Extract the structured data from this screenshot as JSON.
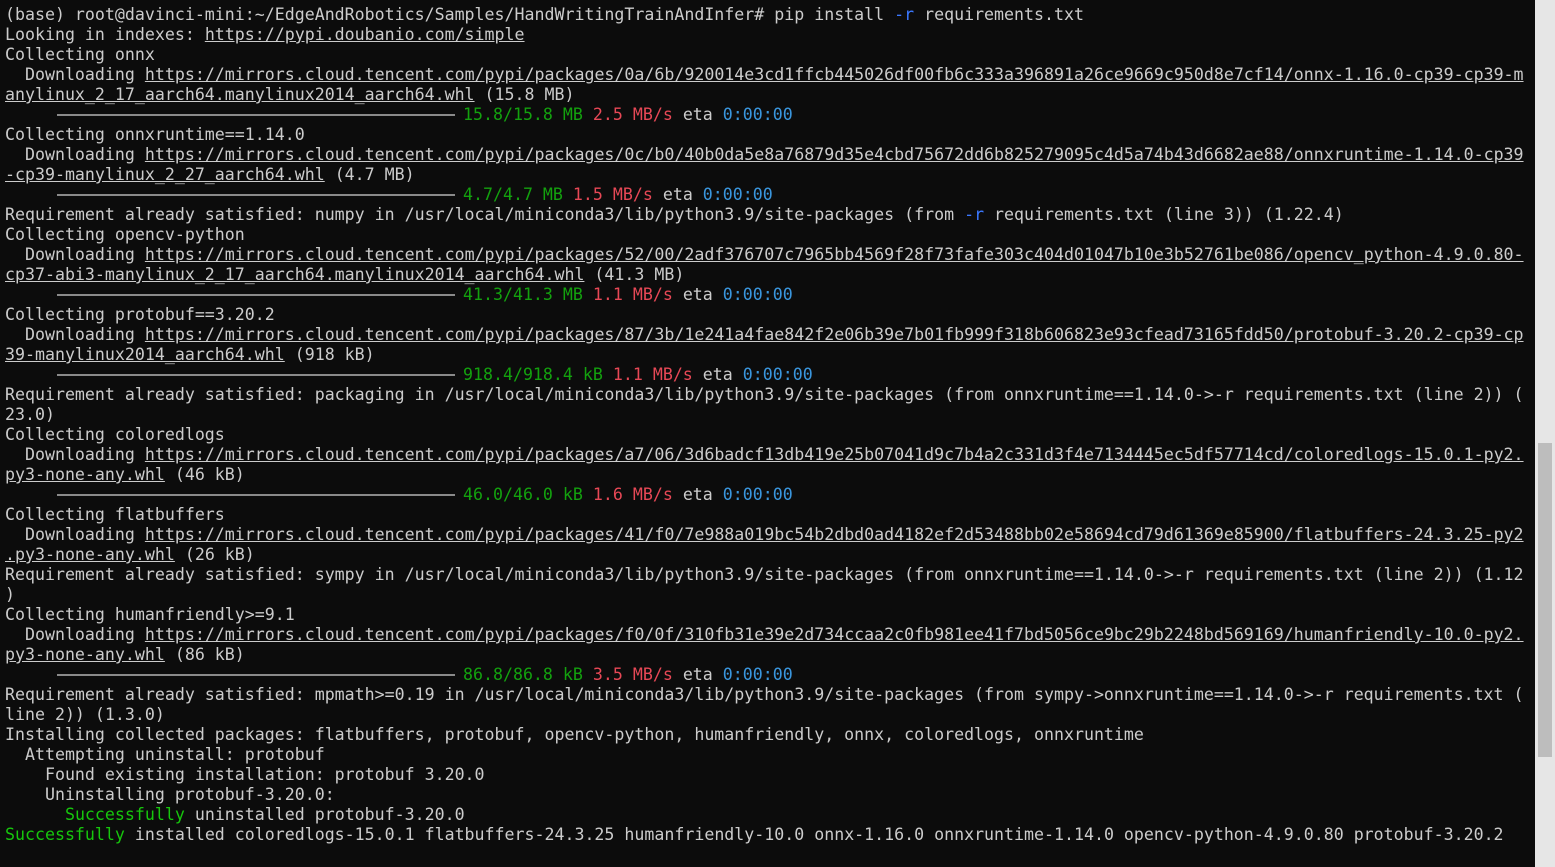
{
  "terminal": {
    "lines": [
      [
        {
          "t": "(base) root@davinci-mini:~/EdgeAndRobotics/Samples/HandWritingTrainAndInfer# pip install "
        },
        {
          "t": "-r",
          "c": "blue"
        },
        {
          "t": " requirements.txt"
        }
      ],
      [
        {
          "t": "Looking in indexes: "
        },
        {
          "t": "https://pypi.doubanio.com/simple",
          "u": true
        }
      ],
      [
        {
          "t": "Collecting onnx"
        }
      ],
      [
        {
          "t": "  Downloading "
        },
        {
          "t": "https://mirrors.cloud.tencent.com/pypi/packages/0a/6b/920014e3cd1ffcb445026df00fb6c333a396891a26ce9669c950d8e7cf14/onnx-1.16.0-cp39-cp39-m",
          "u": true
        }
      ],
      [
        {
          "t": "anylinux_2_17_aarch64.manylinux2014_aarch64.whl",
          "u": true
        },
        {
          "t": " (15.8 MB)"
        }
      ],
      [
        {
          "bar": true
        },
        {
          "t": "15.8/15.8 MB",
          "c": "dgreen"
        },
        {
          "t": " "
        },
        {
          "t": "2.5 MB/s",
          "c": "red"
        },
        {
          "t": " eta "
        },
        {
          "t": "0:00:00",
          "c": "cyan"
        }
      ],
      [
        {
          "t": "Collecting onnxruntime==1.14.0"
        }
      ],
      [
        {
          "t": "  Downloading "
        },
        {
          "t": "https://mirrors.cloud.tencent.com/pypi/packages/0c/b0/40b0da5e8a76879d35e4cbd75672dd6b825279095c4d5a74b43d6682ae88/onnxruntime-1.14.0-cp39",
          "u": true
        }
      ],
      [
        {
          "t": "-cp39-manylinux_2_27_aarch64.whl",
          "u": true
        },
        {
          "t": " (4.7 MB)"
        }
      ],
      [
        {
          "bar": true
        },
        {
          "t": "4.7/4.7 MB",
          "c": "dgreen"
        },
        {
          "t": " "
        },
        {
          "t": "1.5 MB/s",
          "c": "red"
        },
        {
          "t": " eta "
        },
        {
          "t": "0:00:00",
          "c": "cyan"
        }
      ],
      [
        {
          "t": "Requirement already satisfied: numpy in /usr/local/miniconda3/lib/python3.9/site-packages (from "
        },
        {
          "t": "-r",
          "c": "blue"
        },
        {
          "t": " requirements.txt (line 3)) (1.22.4)"
        }
      ],
      [
        {
          "t": "Collecting opencv-python"
        }
      ],
      [
        {
          "t": "  Downloading "
        },
        {
          "t": "https://mirrors.cloud.tencent.com/pypi/packages/52/00/2adf376707c7965bb4569f28f73fafe303c404d01047b10e3b52761be086/opencv_python-4.9.0.80-",
          "u": true
        }
      ],
      [
        {
          "t": "cp37-abi3-manylinux_2_17_aarch64.manylinux2014_aarch64.whl",
          "u": true
        },
        {
          "t": " (41.3 MB)"
        }
      ],
      [
        {
          "bar": true
        },
        {
          "t": "41.3/41.3 MB",
          "c": "dgreen"
        },
        {
          "t": " "
        },
        {
          "t": "1.1 MB/s",
          "c": "red"
        },
        {
          "t": " eta "
        },
        {
          "t": "0:00:00",
          "c": "cyan"
        }
      ],
      [
        {
          "t": "Collecting protobuf==3.20.2"
        }
      ],
      [
        {
          "t": "  Downloading "
        },
        {
          "t": "https://mirrors.cloud.tencent.com/pypi/packages/87/3b/1e241a4fae842f2e06b39e7b01fb999f318b606823e93cfead73165fdd50/protobuf-3.20.2-cp39-cp",
          "u": true
        }
      ],
      [
        {
          "t": "39-manylinux2014_aarch64.whl",
          "u": true
        },
        {
          "t": " (918 kB)"
        }
      ],
      [
        {
          "bar": true
        },
        {
          "t": "918.4/918.4 kB",
          "c": "dgreen"
        },
        {
          "t": " "
        },
        {
          "t": "1.1 MB/s",
          "c": "red"
        },
        {
          "t": " eta "
        },
        {
          "t": "0:00:00",
          "c": "cyan"
        }
      ],
      [
        {
          "t": "Requirement already satisfied: packaging in /usr/local/miniconda3/lib/python3.9/site-packages (from onnxruntime==1.14.0->-r requirements.txt (line 2)) ("
        }
      ],
      [
        {
          "t": "23.0)"
        }
      ],
      [
        {
          "t": "Collecting coloredlogs"
        }
      ],
      [
        {
          "t": "  Downloading "
        },
        {
          "t": "https://mirrors.cloud.tencent.com/pypi/packages/a7/06/3d6badcf13db419e25b07041d9c7b4a2c331d3f4e7134445ec5df57714cd/coloredlogs-15.0.1-py2.",
          "u": true
        }
      ],
      [
        {
          "t": "py3-none-any.whl",
          "u": true
        },
        {
          "t": " (46 kB)"
        }
      ],
      [
        {
          "bar": true
        },
        {
          "t": "46.0/46.0 kB",
          "c": "dgreen"
        },
        {
          "t": " "
        },
        {
          "t": "1.6 MB/s",
          "c": "red"
        },
        {
          "t": " eta "
        },
        {
          "t": "0:00:00",
          "c": "cyan"
        }
      ],
      [
        {
          "t": "Collecting flatbuffers"
        }
      ],
      [
        {
          "t": "  Downloading "
        },
        {
          "t": "https://mirrors.cloud.tencent.com/pypi/packages/41/f0/7e988a019bc54b2dbd0ad4182ef2d53488bb02e58694cd79d61369e85900/flatbuffers-24.3.25-py2",
          "u": true
        }
      ],
      [
        {
          "t": ".py3-none-any.whl",
          "u": true
        },
        {
          "t": " (26 kB)"
        }
      ],
      [
        {
          "t": "Requirement already satisfied: sympy in /usr/local/miniconda3/lib/python3.9/site-packages (from onnxruntime==1.14.0->-r requirements.txt (line 2)) (1.12"
        }
      ],
      [
        {
          "t": ")"
        }
      ],
      [
        {
          "t": "Collecting humanfriendly>=9.1"
        }
      ],
      [
        {
          "t": "  Downloading "
        },
        {
          "t": "https://mirrors.cloud.tencent.com/pypi/packages/f0/0f/310fb31e39e2d734ccaa2c0fb981ee41f7bd5056ce9bc29b2248bd569169/humanfriendly-10.0-py2.",
          "u": true
        }
      ],
      [
        {
          "t": "py3-none-any.whl",
          "u": true
        },
        {
          "t": " (86 kB)"
        }
      ],
      [
        {
          "bar": true
        },
        {
          "t": "86.8/86.8 kB",
          "c": "dgreen"
        },
        {
          "t": " "
        },
        {
          "t": "3.5 MB/s",
          "c": "red"
        },
        {
          "t": " eta "
        },
        {
          "t": "0:00:00",
          "c": "cyan"
        }
      ],
      [
        {
          "t": "Requirement already satisfied: mpmath>=0.19 in /usr/local/miniconda3/lib/python3.9/site-packages (from sympy->onnxruntime==1.14.0->-r requirements.txt ("
        }
      ],
      [
        {
          "t": "line 2)) (1.3.0)"
        }
      ],
      [
        {
          "t": "Installing collected packages: flatbuffers, protobuf, opencv-python, humanfriendly, onnx, coloredlogs, onnxruntime"
        }
      ],
      [
        {
          "t": "  Attempting uninstall: protobuf"
        }
      ],
      [
        {
          "t": "    Found existing installation: protobuf 3.20.0"
        }
      ],
      [
        {
          "t": "    Uninstalling protobuf-3.20.0:"
        }
      ],
      [
        {
          "t": "      "
        },
        {
          "t": "Successfully",
          "c": "green"
        },
        {
          "t": " uninstalled protobuf-3.20.0"
        }
      ],
      [
        {
          "t": "Successfully",
          "c": "green"
        },
        {
          "t": " installed coloredlogs-15.0.1 flatbuffers-24.3.25 humanfriendly-10.0 onnx-1.16.0 onnxruntime-1.14.0 opencv-python-4.9.0.80 protobuf-3.20.2"
        }
      ]
    ]
  },
  "colors": {
    "background": "#0c0c0c",
    "default_text": "#cccccc",
    "green": "#16c60c",
    "dgreen": "#13a10e",
    "red": "#e74856",
    "cyan": "#3a96dd",
    "blue": "#3b78ff"
  }
}
